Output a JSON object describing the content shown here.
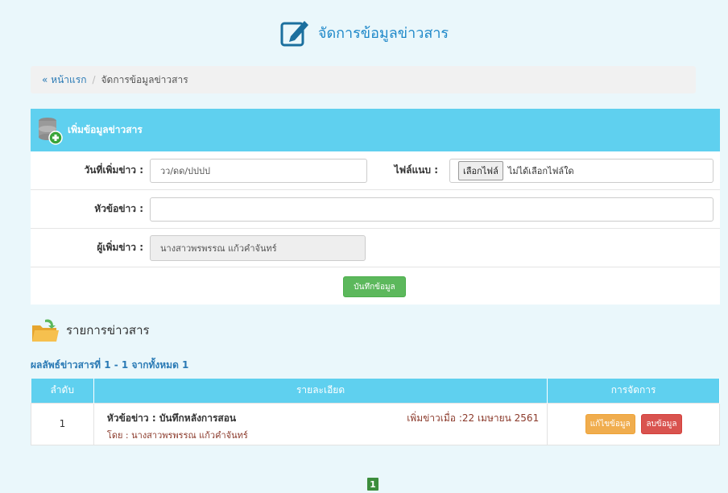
{
  "header": {
    "title": "จัดการข้อมูลข่าวสาร",
    "icon": "edit-note-icon"
  },
  "breadcrumb": {
    "home": "« หน้าแรก",
    "separator": "/",
    "current": "จัดการข้อมูลข่าวสาร"
  },
  "form": {
    "title": "เพิ่มข้อมูลข่าวสาร",
    "icon": "database-add-icon",
    "date_label": "วันที่เพิ่มข่าว :",
    "date_placeholder": "วว/ดด/ปปปป",
    "file_label": "ไฟล์แนบ :",
    "file_button": "เลือกไฟล์",
    "file_status": "ไม่ได้เลือกไฟล์ใด",
    "headline_label": "หัวข้อข่าว :",
    "headline_value": "",
    "author_label": "ผู้เพิ่มข่าว :",
    "author_value": "นางสาวพรพรรณ แก้วคำจันทร์",
    "save_button": "บันทึกข้อมูล"
  },
  "list": {
    "title": "รายการข่าวสาร",
    "icon": "folder-icon",
    "result_info": "ผลลัพธ์ข่าวสารที่ 1 - 1 จากทั้งหมด 1",
    "columns": [
      "ลำดับ",
      "รายละเอียด",
      "การจัดการ"
    ],
    "rows": [
      {
        "no": "1",
        "title": "หัวข้อข่าว : บันทึกหลังการสอน",
        "date": "เพิ่มข่าวเมื่อ :22 เมษายน 2561",
        "author": "โดย : นางสาวพรพรรณ แก้วคำจันทร์",
        "edit_label": "แก้ไขข้อมูล",
        "delete_label": "ลบข้อมูล"
      }
    ]
  },
  "pagination": {
    "current_page": "1"
  },
  "colors": {
    "accent": "#5fd0ef",
    "link": "#2a7ab5",
    "success": "#5cb85c",
    "warning": "#f0ad4e",
    "danger": "#d9534f"
  }
}
